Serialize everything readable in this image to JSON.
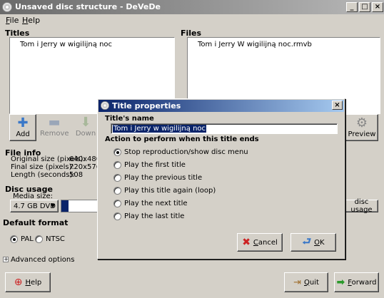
{
  "window": {
    "title": "Unsaved disc structure - DeVeDe"
  },
  "menu": {
    "file": "File",
    "help": "Help"
  },
  "titles": {
    "label": "Titles",
    "items": [
      "Tom i Jerry w wigilijną noc"
    ],
    "add": "Add",
    "remove": "Remove",
    "down": "Down"
  },
  "files": {
    "label": "Files",
    "items": [
      "Tom i Jerry W wigilijną  noc.rmvb"
    ],
    "preview": "Preview"
  },
  "file_info": {
    "label": "File info",
    "rows": [
      {
        "k": "Original size (pixels):",
        "v": "640x480"
      },
      {
        "k": "Final size (pixels):",
        "v": "720x576"
      },
      {
        "k": "Length (seconds):",
        "v": "508"
      }
    ]
  },
  "disc_usage": {
    "label": "Disc usage",
    "media_label": "Media size:",
    "media_value": "4.7 GB DVD",
    "adjust_button": "disc usage",
    "bar_fill": 0.2
  },
  "default_format": {
    "label": "Default format",
    "pal": "PAL",
    "ntsc": "NTSC",
    "selected": "PAL"
  },
  "advanced": {
    "label": "Advanced options"
  },
  "bottom": {
    "help": "Help",
    "quit": "Quit",
    "forward": "Forward"
  },
  "dialog": {
    "title": "Title properties",
    "name_label": "Title's name",
    "name_value": "Tom i Jerry w wigilijną noc",
    "action_label": "Action to perform when this title ends",
    "options": [
      "Stop reproduction/show disc menu",
      "Play the first title",
      "Play the previous title",
      "Play this title again (loop)",
      "Play the next title",
      "Play the last title"
    ],
    "selected_index": 0,
    "cancel": "Cancel",
    "ok": "OK"
  },
  "colors": {
    "selection": "#0a246a",
    "disc_bar": "#0a246a",
    "cancel_icon": "#cc2222",
    "ok_icon": "#3a78c8",
    "add_icon": "#3a78c8",
    "forward_icon": "#2a9a2a"
  }
}
